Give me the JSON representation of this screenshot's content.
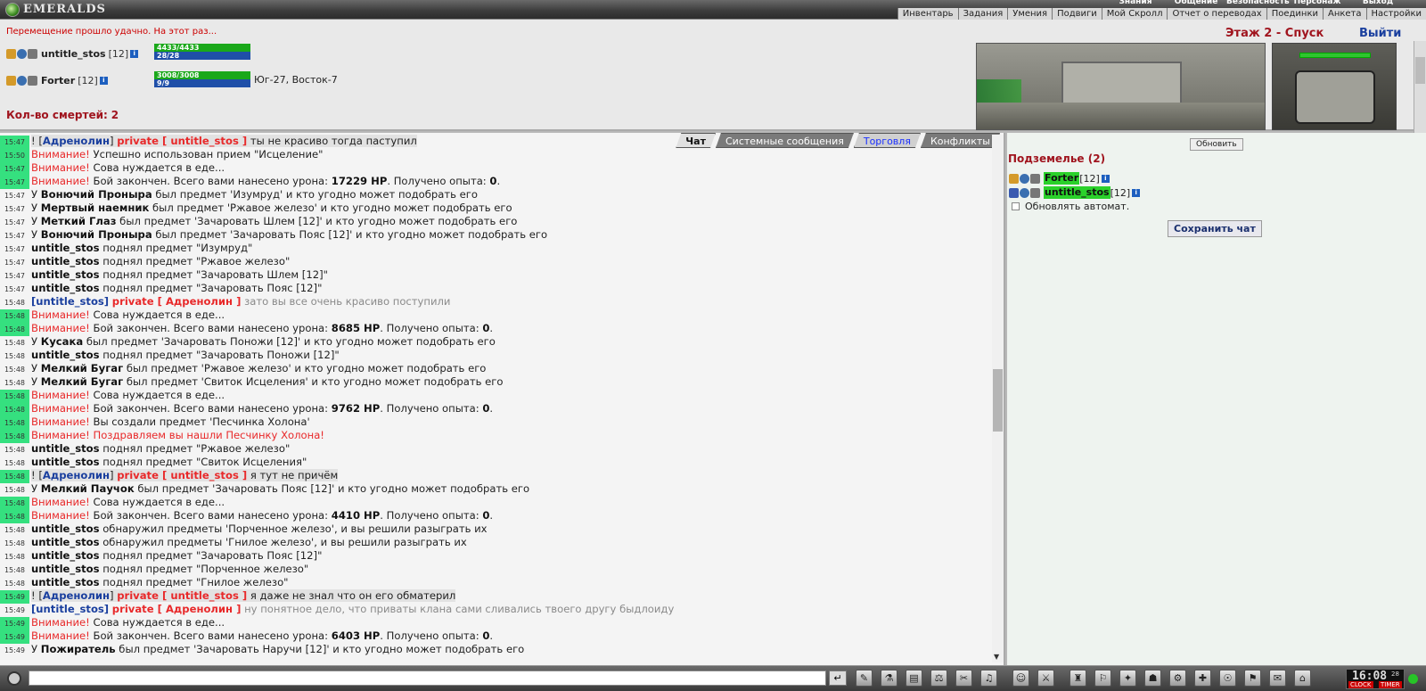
{
  "app": {
    "logo_text": "EMERALDS"
  },
  "top_menu": {
    "upper": [
      "Знания",
      "Общение",
      "Безопасность",
      "Персонаж",
      "Выход"
    ],
    "items": [
      "Инвентарь",
      "Задания",
      "Умения",
      "Подвиги",
      "Мой Скролл",
      "Отчет о переводах",
      "Поединки",
      "Анкета",
      "Настройки"
    ]
  },
  "header": {
    "move_message": "Перемещение прошло удачно. На этот раз...",
    "floor": "Этаж 2 - Спуск",
    "exit": "Выйти",
    "deaths_label": "Кол-во смертей:",
    "deaths_value": "2",
    "coords": "Юг-27, Восток-7",
    "players": [
      {
        "name": "untitle_stos",
        "level": "[12]",
        "hp": "4433/4433",
        "mp": "28/28",
        "hp_fill": 1.0,
        "mp_fill": 1.0
      },
      {
        "name": "Forter",
        "level": "[12]",
        "hp": "3008/3008",
        "mp": "9/9",
        "hp_fill": 1.0,
        "mp_fill": 1.0
      }
    ]
  },
  "tabs": [
    "Чат",
    "Системные сообщения",
    "Торговля",
    "Конфликты"
  ],
  "chat": [
    {
      "t": "15:47",
      "g": true,
      "parts": [
        [
          "",
          "! ["
        ],
        [
          "bl",
          "Адренолин"
        ],
        [
          "",
          "] "
        ],
        [
          "pv",
          "private [ untitle_stos ]"
        ],
        [
          "",
          " ты не красиво тогда паступил"
        ]
      ],
      "hl": true
    },
    {
      "t": "15:50",
      "g": true,
      "parts": [
        [
          "w",
          "Внимание!"
        ],
        [
          "",
          " Успешно использован прием \"Исцеление\""
        ]
      ]
    },
    {
      "t": "15:47",
      "g": true,
      "parts": [
        [
          "w",
          "Внимание!"
        ],
        [
          "",
          " Сова нуждается в еде..."
        ]
      ]
    },
    {
      "t": "15:47",
      "g": true,
      "parts": [
        [
          "w",
          "Внимание!"
        ],
        [
          "",
          " Бой закончен. Всего вами нанесено урона: "
        ],
        [
          "b",
          "17229 HP"
        ],
        [
          "",
          ". Получено опыта: "
        ],
        [
          "b",
          "0"
        ],
        [
          "",
          "."
        ]
      ]
    },
    {
      "t": "15:47",
      "g": false,
      "parts": [
        [
          "",
          "У "
        ],
        [
          "b",
          "Вонючий Проныра"
        ],
        [
          "",
          " был предмет 'Изумруд' и кто угодно может подобрать его"
        ]
      ]
    },
    {
      "t": "15:47",
      "g": false,
      "parts": [
        [
          "",
          "У "
        ],
        [
          "b",
          "Мертвый наемник"
        ],
        [
          "",
          " был предмет 'Ржавое железо' и кто угодно может подобрать его"
        ]
      ]
    },
    {
      "t": "15:47",
      "g": false,
      "parts": [
        [
          "",
          "У "
        ],
        [
          "b",
          "Меткий Глаз"
        ],
        [
          "",
          " был предмет 'Зачаровать Шлем [12]' и кто угодно может подобрать его"
        ]
      ]
    },
    {
      "t": "15:47",
      "g": false,
      "parts": [
        [
          "",
          "У "
        ],
        [
          "b",
          "Вонючий Проныра"
        ],
        [
          "",
          " был предмет 'Зачаровать Пояс [12]' и кто угодно может подобрать его"
        ]
      ]
    },
    {
      "t": "15:47",
      "g": false,
      "parts": [
        [
          "b",
          "untitle_stos"
        ],
        [
          "",
          " поднял предмет \"Изумруд\""
        ]
      ]
    },
    {
      "t": "15:47",
      "g": false,
      "parts": [
        [
          "b",
          "untitle_stos"
        ],
        [
          "",
          " поднял предмет \"Ржавое железо\""
        ]
      ]
    },
    {
      "t": "15:47",
      "g": false,
      "parts": [
        [
          "b",
          "untitle_stos"
        ],
        [
          "",
          " поднял предмет \"Зачаровать Шлем [12]\""
        ]
      ]
    },
    {
      "t": "15:47",
      "g": false,
      "parts": [
        [
          "b",
          "untitle_stos"
        ],
        [
          "",
          " поднял предмет \"Зачаровать Пояс [12]\""
        ]
      ]
    },
    {
      "t": "15:48",
      "g": false,
      "parts": [
        [
          "bl",
          "[untitle_stos]"
        ],
        [
          "",
          " "
        ],
        [
          "pv",
          "private [ Адренолин ]"
        ],
        [
          "gry",
          " зато вы все очень красиво поступили"
        ]
      ]
    },
    {
      "t": "15:48",
      "g": true,
      "parts": [
        [
          "w",
          "Внимание!"
        ],
        [
          "",
          " Сова нуждается в еде..."
        ]
      ]
    },
    {
      "t": "15:48",
      "g": true,
      "parts": [
        [
          "w",
          "Внимание!"
        ],
        [
          "",
          " Бой закончен. Всего вами нанесено урона: "
        ],
        [
          "b",
          "8685 HP"
        ],
        [
          "",
          ". Получено опыта: "
        ],
        [
          "b",
          "0"
        ],
        [
          "",
          "."
        ]
      ]
    },
    {
      "t": "15:48",
      "g": false,
      "parts": [
        [
          "",
          "У "
        ],
        [
          "b",
          "Кусака"
        ],
        [
          "",
          " был предмет 'Зачаровать Поножи [12]' и кто угодно может подобрать его"
        ]
      ]
    },
    {
      "t": "15:48",
      "g": false,
      "parts": [
        [
          "b",
          "untitle_stos"
        ],
        [
          "",
          " поднял предмет \"Зачаровать Поножи [12]\""
        ]
      ]
    },
    {
      "t": "15:48",
      "g": false,
      "parts": [
        [
          "",
          "У "
        ],
        [
          "b",
          "Мелкий Бугаг"
        ],
        [
          "",
          " был предмет 'Ржавое железо' и кто угодно может подобрать его"
        ]
      ]
    },
    {
      "t": "15:48",
      "g": false,
      "parts": [
        [
          "",
          "У "
        ],
        [
          "b",
          "Мелкий Бугаг"
        ],
        [
          "",
          " был предмет 'Свиток Исцеления' и кто угодно может подобрать его"
        ]
      ]
    },
    {
      "t": "15:48",
      "g": true,
      "parts": [
        [
          "w",
          "Внимание!"
        ],
        [
          "",
          " Сова нуждается в еде..."
        ]
      ]
    },
    {
      "t": "15:48",
      "g": true,
      "parts": [
        [
          "w",
          "Внимание!"
        ],
        [
          "",
          " Бой закончен. Всего вами нанесено урона: "
        ],
        [
          "b",
          "9762 HP"
        ],
        [
          "",
          ". Получено опыта: "
        ],
        [
          "b",
          "0"
        ],
        [
          "",
          "."
        ]
      ]
    },
    {
      "t": "15:48",
      "g": true,
      "parts": [
        [
          "w",
          "Внимание!"
        ],
        [
          "",
          " Вы создали предмет 'Песчинка Холона'"
        ]
      ]
    },
    {
      "t": "15:48",
      "g": true,
      "parts": [
        [
          "w",
          "Внимание! Поздравляем вы нашли Песчинку Холона!"
        ]
      ]
    },
    {
      "t": "15:48",
      "g": false,
      "parts": [
        [
          "b",
          "untitle_stos"
        ],
        [
          "",
          " поднял предмет \"Ржавое железо\""
        ]
      ]
    },
    {
      "t": "15:48",
      "g": false,
      "parts": [
        [
          "b",
          "untitle_stos"
        ],
        [
          "",
          " поднял предмет \"Свиток Исцеления\""
        ]
      ]
    },
    {
      "t": "15:48",
      "g": true,
      "parts": [
        [
          "",
          "! ["
        ],
        [
          "bl",
          "Адренолин"
        ],
        [
          "",
          "] "
        ],
        [
          "pv",
          "private [ untitle_stos ]"
        ],
        [
          "",
          " я тут не причём"
        ]
      ],
      "hl": true
    },
    {
      "t": "15:48",
      "g": false,
      "parts": [
        [
          "",
          "У "
        ],
        [
          "b",
          "Мелкий Паучок"
        ],
        [
          "",
          " был предмет 'Зачаровать Пояс [12]' и кто угодно может подобрать его"
        ]
      ]
    },
    {
      "t": "15:48",
      "g": true,
      "parts": [
        [
          "w",
          "Внимание!"
        ],
        [
          "",
          " Сова нуждается в еде..."
        ]
      ]
    },
    {
      "t": "15:48",
      "g": true,
      "parts": [
        [
          "w",
          "Внимание!"
        ],
        [
          "",
          " Бой закончен. Всего вами нанесено урона: "
        ],
        [
          "b",
          "4410 HP"
        ],
        [
          "",
          ". Получено опыта: "
        ],
        [
          "b",
          "0"
        ],
        [
          "",
          "."
        ]
      ]
    },
    {
      "t": "15:48",
      "g": false,
      "parts": [
        [
          "b",
          "untitle_stos"
        ],
        [
          "",
          " обнаружил предметы 'Порченное железо', и вы решили разыграть их"
        ]
      ]
    },
    {
      "t": "15:48",
      "g": false,
      "parts": [
        [
          "b",
          "untitle_stos"
        ],
        [
          "",
          " обнаружил предметы 'Гнилое железо', и вы решили разыграть их"
        ]
      ]
    },
    {
      "t": "15:48",
      "g": false,
      "parts": [
        [
          "b",
          "untitle_stos"
        ],
        [
          "",
          " поднял предмет \"Зачаровать Пояс [12]\""
        ]
      ]
    },
    {
      "t": "15:48",
      "g": false,
      "parts": [
        [
          "b",
          "untitle_stos"
        ],
        [
          "",
          " поднял предмет \"Порченное железо\""
        ]
      ]
    },
    {
      "t": "15:48",
      "g": false,
      "parts": [
        [
          "b",
          "untitle_stos"
        ],
        [
          "",
          " поднял предмет \"Гнилое железо\""
        ]
      ]
    },
    {
      "t": "15:49",
      "g": true,
      "parts": [
        [
          "",
          "! ["
        ],
        [
          "bl",
          "Адренолин"
        ],
        [
          "",
          "] "
        ],
        [
          "pv",
          "private [ untitle_stos ]"
        ],
        [
          "",
          " я даже не знал что он его обматерил"
        ]
      ],
      "hl": true
    },
    {
      "t": "15:49",
      "g": false,
      "parts": [
        [
          "bl",
          "[untitle_stos]"
        ],
        [
          "",
          " "
        ],
        [
          "pv",
          "private [ Адренолин ]"
        ],
        [
          "gry",
          " ну понятное дело, что приваты клана сами сливались твоего другу быдлоиду"
        ]
      ]
    },
    {
      "t": "15:49",
      "g": true,
      "parts": [
        [
          "w",
          "Внимание!"
        ],
        [
          "",
          " Сова нуждается в еде..."
        ]
      ]
    },
    {
      "t": "15:49",
      "g": true,
      "parts": [
        [
          "w",
          "Внимание!"
        ],
        [
          "",
          " Бой закончен. Всего вами нанесено урона: "
        ],
        [
          "b",
          "6403 HP"
        ],
        [
          "",
          ". Получено опыта: "
        ],
        [
          "b",
          "0"
        ],
        [
          "",
          "."
        ]
      ]
    },
    {
      "t": "15:49",
      "g": false,
      "parts": [
        [
          "",
          "У "
        ],
        [
          "b",
          "Пожиратель"
        ],
        [
          "",
          " был предмет 'Зачаровать Наручи [12]' и кто угодно может подобрать его"
        ]
      ]
    }
  ],
  "side": {
    "refresh": "Обновить",
    "dungeon_title": "Подземелье (2)",
    "players": [
      {
        "name": "Forter",
        "level": "[12]"
      },
      {
        "name": "untitle_stos",
        "level": "[12]"
      }
    ],
    "auto_refresh": "Обновлять автомат.",
    "save_chat": "Сохранить чат"
  },
  "bottom": {
    "time": "16:08",
    "seconds": "28",
    "clock_label": "CLOCK",
    "timer_label": "TIMER",
    "tools": [
      "✎",
      "⚗",
      "▤",
      "⚖",
      "✂",
      "♫",
      "☺",
      "⚔",
      "♜",
      "⚐",
      "✦",
      "☗",
      "⚙",
      "✚",
      "☉",
      "⚑",
      "✉",
      "⌂"
    ]
  }
}
